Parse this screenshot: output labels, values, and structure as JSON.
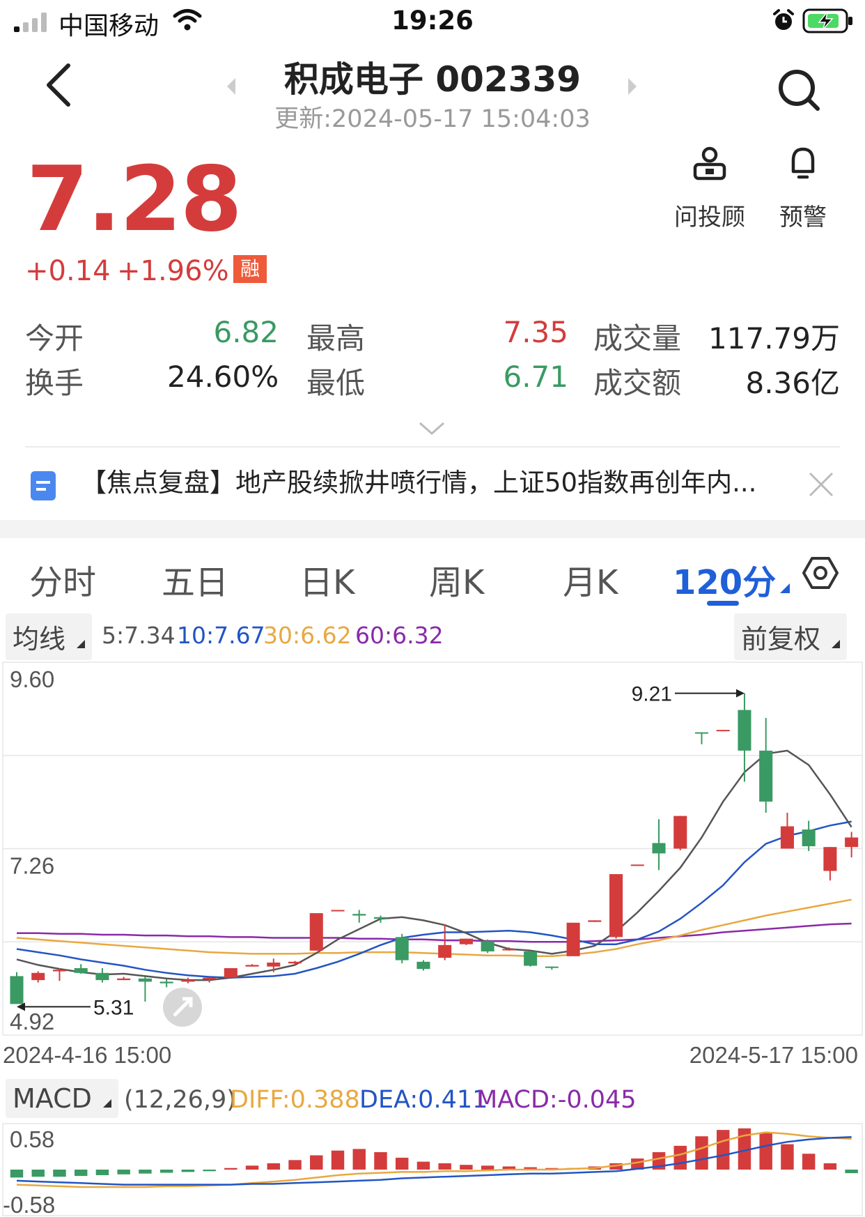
{
  "status": {
    "carrier": "中国移动",
    "time": "19:26"
  },
  "header": {
    "title": "积成电子 002339",
    "updated": "更新:2024-05-17 15:04:03"
  },
  "quote": {
    "price": "7.28",
    "change": "+0.14",
    "change_pct": "+1.96%",
    "margin_badge": "融"
  },
  "actions": {
    "advisor": "问投顾",
    "alert": "预警"
  },
  "stats": [
    {
      "label": "今开",
      "value": "6.82",
      "color": "green"
    },
    {
      "label": "最高",
      "value": "7.35",
      "color": "red"
    },
    {
      "label": "成交量",
      "value": "117.79万",
      "color": "dark"
    },
    {
      "label": "换手",
      "value": "24.60%",
      "color": "dark"
    },
    {
      "label": "最低",
      "value": "6.71",
      "color": "green"
    },
    {
      "label": "成交额",
      "value": "8.36亿",
      "color": "dark"
    }
  ],
  "news": {
    "text": "【焦点复盘】地产股续掀井喷行情，上证50指数再创年内..."
  },
  "tabs": [
    "分时",
    "五日",
    "日K",
    "周K",
    "月K",
    "120分"
  ],
  "active_tab": "120分",
  "ma": {
    "button": "均线",
    "ma5": "5:7.34",
    "ma10": "10:7.67",
    "ma30": "30:6.62",
    "ma60": "60:6.32",
    "adjust": "前复权"
  },
  "colors": {
    "up": "#d43c3c",
    "down": "#3a9a63",
    "ma5": "#555555",
    "ma10": "#2255c4",
    "ma30": "#e8a840",
    "ma60": "#8a2aa8",
    "accent": "#1f5fd8"
  },
  "macd": {
    "button": "MACD",
    "params": "(12,26,9)",
    "diff": "DIFF:0.388",
    "dea": "DEA:0.411",
    "macd": "MACD:-0.045"
  },
  "chart_data": [
    {
      "type": "candlestick",
      "title": "",
      "y_axis_labels": [
        "9.60",
        "7.26",
        "4.92"
      ],
      "ylim": [
        4.92,
        9.6
      ],
      "x_labels": [
        "2024-4-16 15:00",
        "2024-5-17 15:00"
      ],
      "annotations": [
        {
          "text": "9.21",
          "value": 9.21
        },
        {
          "text": "5.31",
          "value": 5.31
        }
      ],
      "candles": [
        {
          "o": 5.66,
          "c": 5.31,
          "h": 5.71,
          "l": 5.31
        },
        {
          "o": 5.61,
          "c": 5.7,
          "h": 5.72,
          "l": 5.58
        },
        {
          "o": 5.72,
          "c": 5.74,
          "h": 5.76,
          "l": 5.6
        },
        {
          "o": 5.76,
          "c": 5.7,
          "h": 5.81,
          "l": 5.69
        },
        {
          "o": 5.7,
          "c": 5.61,
          "h": 5.76,
          "l": 5.58
        },
        {
          "o": 5.61,
          "c": 5.63,
          "h": 5.65,
          "l": 5.61
        },
        {
          "o": 5.63,
          "c": 5.59,
          "h": 5.65,
          "l": 5.34
        },
        {
          "o": 5.59,
          "c": 5.57,
          "h": 5.62,
          "l": 5.52
        },
        {
          "o": 5.59,
          "c": 5.61,
          "h": 5.64,
          "l": 5.57
        },
        {
          "o": 5.62,
          "c": 5.64,
          "h": 5.64,
          "l": 5.58
        },
        {
          "o": 5.64,
          "c": 5.76,
          "h": 5.76,
          "l": 5.64
        },
        {
          "o": 5.78,
          "c": 5.8,
          "h": 5.81,
          "l": 5.78
        },
        {
          "o": 5.78,
          "c": 5.83,
          "h": 5.88,
          "l": 5.71
        },
        {
          "o": 5.82,
          "c": 5.84,
          "h": 5.85,
          "l": 5.8
        },
        {
          "o": 5.98,
          "c": 6.45,
          "h": 6.45,
          "l": 5.98
        },
        {
          "o": 6.48,
          "c": 6.49,
          "h": 6.49,
          "l": 6.48
        },
        {
          "o": 6.44,
          "c": 6.42,
          "h": 6.49,
          "l": 6.33
        },
        {
          "o": 6.4,
          "c": 6.38,
          "h": 6.42,
          "l": 6.33
        },
        {
          "o": 6.15,
          "c": 5.86,
          "h": 6.19,
          "l": 5.82
        },
        {
          "o": 5.84,
          "c": 5.75,
          "h": 5.86,
          "l": 5.73
        },
        {
          "o": 5.89,
          "c": 6.05,
          "h": 6.31,
          "l": 5.86
        },
        {
          "o": 6.06,
          "c": 6.13,
          "h": 6.13,
          "l": 6.05
        },
        {
          "o": 6.1,
          "c": 5.97,
          "h": 6.12,
          "l": 5.95
        },
        {
          "o": 5.99,
          "c": 6.0,
          "h": 6.02,
          "l": 5.98
        },
        {
          "o": 5.97,
          "c": 5.79,
          "h": 5.98,
          "l": 5.78
        },
        {
          "o": 5.78,
          "c": 5.77,
          "h": 5.78,
          "l": 5.74
        },
        {
          "o": 5.91,
          "c": 6.33,
          "h": 6.33,
          "l": 5.91
        },
        {
          "o": 6.34,
          "c": 6.36,
          "h": 6.36,
          "l": 6.34
        },
        {
          "o": 6.15,
          "c": 6.94,
          "h": 6.94,
          "l": 6.13
        },
        {
          "o": 7.05,
          "c": 7.06,
          "h": 7.06,
          "l": 7.05
        },
        {
          "o": 7.33,
          "c": 7.2,
          "h": 7.63,
          "l": 6.99
        },
        {
          "o": 7.26,
          "c": 7.67,
          "h": 7.67,
          "l": 7.24
        },
        {
          "o": 8.72,
          "c": 8.71,
          "h": 8.72,
          "l": 8.57
        },
        {
          "o": 8.74,
          "c": 8.75,
          "h": 8.75,
          "l": 8.74
        },
        {
          "o": 9.0,
          "c": 8.49,
          "h": 9.21,
          "l": 8.1
        },
        {
          "o": 8.49,
          "c": 7.85,
          "h": 8.9,
          "l": 7.71
        },
        {
          "o": 7.26,
          "c": 7.54,
          "h": 7.71,
          "l": 7.26
        },
        {
          "o": 7.5,
          "c": 7.29,
          "h": 7.61,
          "l": 7.23
        },
        {
          "o": 6.98,
          "c": 7.28,
          "h": 7.28,
          "l": 6.86
        },
        {
          "o": 7.28,
          "c": 7.4,
          "h": 7.47,
          "l": 7.15
        }
      ],
      "series": [
        {
          "name": "MA5",
          "values": [
            5.87,
            5.8,
            5.75,
            5.71,
            5.68,
            5.69,
            5.66,
            5.63,
            5.61,
            5.61,
            5.64,
            5.69,
            5.74,
            5.8,
            5.95,
            6.12,
            6.25,
            6.38,
            6.4,
            6.36,
            6.3,
            6.2,
            6.08,
            6.0,
            5.98,
            5.94,
            5.98,
            6.04,
            6.22,
            6.46,
            6.73,
            7.02,
            7.4,
            7.85,
            8.22,
            8.45,
            8.49,
            8.31,
            7.94,
            7.53
          ]
        },
        {
          "name": "MA10",
          "values": [
            6.0,
            5.96,
            5.92,
            5.87,
            5.83,
            5.79,
            5.74,
            5.7,
            5.67,
            5.65,
            5.64,
            5.65,
            5.66,
            5.69,
            5.76,
            5.84,
            5.94,
            6.05,
            6.14,
            6.18,
            6.21,
            6.21,
            6.22,
            6.23,
            6.21,
            6.17,
            6.12,
            6.06,
            6.06,
            6.12,
            6.22,
            6.38,
            6.58,
            6.8,
            7.09,
            7.32,
            7.42,
            7.48,
            7.55,
            7.6
          ]
        },
        {
          "name": "MA30",
          "values": [
            6.14,
            6.12,
            6.1,
            6.08,
            6.06,
            6.04,
            6.02,
            6.0,
            5.98,
            5.96,
            5.95,
            5.94,
            5.94,
            5.94,
            5.95,
            5.95,
            5.96,
            5.96,
            5.96,
            5.95,
            5.94,
            5.93,
            5.92,
            5.92,
            5.91,
            5.91,
            5.93,
            5.96,
            6.0,
            6.06,
            6.11,
            6.17,
            6.24,
            6.3,
            6.36,
            6.42,
            6.47,
            6.52,
            6.57,
            6.62
          ]
        },
        {
          "name": "MA60",
          "values": [
            6.2,
            6.2,
            6.19,
            6.19,
            6.18,
            6.18,
            6.17,
            6.17,
            6.16,
            6.16,
            6.15,
            6.15,
            6.14,
            6.14,
            6.14,
            6.14,
            6.13,
            6.13,
            6.12,
            6.12,
            6.11,
            6.11,
            6.1,
            6.1,
            6.09,
            6.09,
            6.09,
            6.1,
            6.11,
            6.12,
            6.14,
            6.16,
            6.18,
            6.21,
            6.23,
            6.25,
            6.27,
            6.29,
            6.31,
            6.32
          ]
        }
      ]
    },
    {
      "type": "bar",
      "title": "",
      "y_axis_labels": [
        "0.58",
        "-0.58"
      ],
      "ylim": [
        -0.58,
        0.58
      ],
      "series": [
        {
          "name": "MACD",
          "values": [
            -0.1,
            -0.09,
            -0.09,
            -0.08,
            -0.07,
            -0.06,
            -0.05,
            -0.04,
            -0.03,
            -0.02,
            0.02,
            0.05,
            0.08,
            0.12,
            0.18,
            0.24,
            0.26,
            0.22,
            0.15,
            0.1,
            0.08,
            0.06,
            0.05,
            0.04,
            0.03,
            0.02,
            0.02,
            0.04,
            0.08,
            0.14,
            0.22,
            0.3,
            0.42,
            0.5,
            0.52,
            0.46,
            0.32,
            0.2,
            0.08,
            -0.045
          ]
        },
        {
          "name": "DIFF",
          "values": [
            -0.19,
            -0.2,
            -0.21,
            -0.22,
            -0.22,
            -0.22,
            -0.22,
            -0.21,
            -0.21,
            -0.2,
            -0.19,
            -0.17,
            -0.15,
            -0.13,
            -0.1,
            -0.07,
            -0.05,
            -0.04,
            -0.03,
            -0.03,
            -0.02,
            -0.02,
            -0.01,
            0.0,
            0.0,
            0.0,
            0.01,
            0.02,
            0.05,
            0.09,
            0.14,
            0.19,
            0.27,
            0.36,
            0.43,
            0.47,
            0.45,
            0.42,
            0.4,
            0.388
          ]
        },
        {
          "name": "DEA",
          "values": [
            -0.14,
            -0.15,
            -0.16,
            -0.17,
            -0.18,
            -0.19,
            -0.19,
            -0.19,
            -0.19,
            -0.19,
            -0.19,
            -0.18,
            -0.18,
            -0.17,
            -0.16,
            -0.15,
            -0.14,
            -0.13,
            -0.11,
            -0.1,
            -0.09,
            -0.08,
            -0.07,
            -0.06,
            -0.05,
            -0.05,
            -0.04,
            -0.03,
            -0.02,
            0.01,
            0.04,
            0.08,
            0.13,
            0.18,
            0.24,
            0.3,
            0.35,
            0.38,
            0.4,
            0.411
          ]
        }
      ]
    }
  ]
}
